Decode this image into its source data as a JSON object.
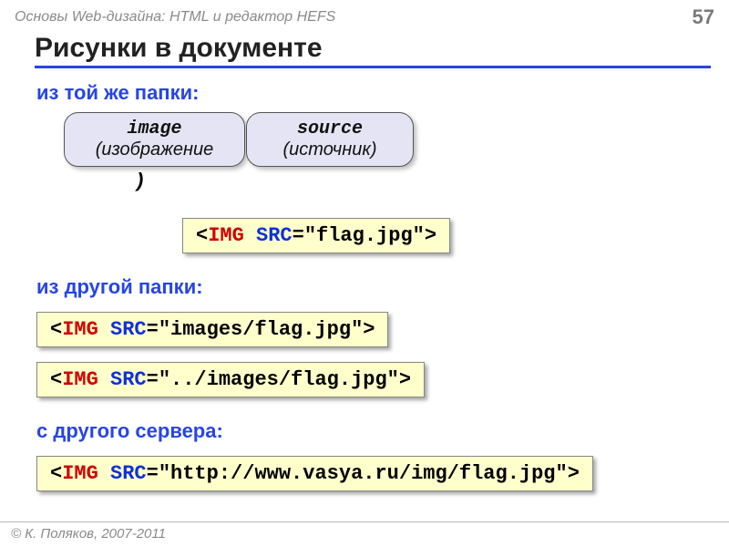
{
  "header": {
    "course": "Основы Web-дизайна: HTML и редактор HEFS",
    "page": "57"
  },
  "title": "Рисунки в документе",
  "sections": {
    "s1": "из той же папки:",
    "s2": "из другой папки:",
    "s3": "с другого сервера:"
  },
  "bubbles": {
    "b1": {
      "title": "image",
      "sub": "(изображение"
    },
    "b1_tail": ")",
    "b2": {
      "title": "source",
      "sub": "(источник)"
    }
  },
  "code": {
    "angle_open": "<",
    "angle_close": ">",
    "tag": "IMG",
    "sp": " ",
    "attr": "SRC",
    "eq": "=",
    "v1": "\"flag.jpg\"",
    "v2": "\"images/flag.jpg\"",
    "v3": "\"../images/flag.jpg\"",
    "v4": "\"http://www.vasya.ru/img/flag.jpg\""
  },
  "footer": "© К. Поляков, 2007-2011"
}
